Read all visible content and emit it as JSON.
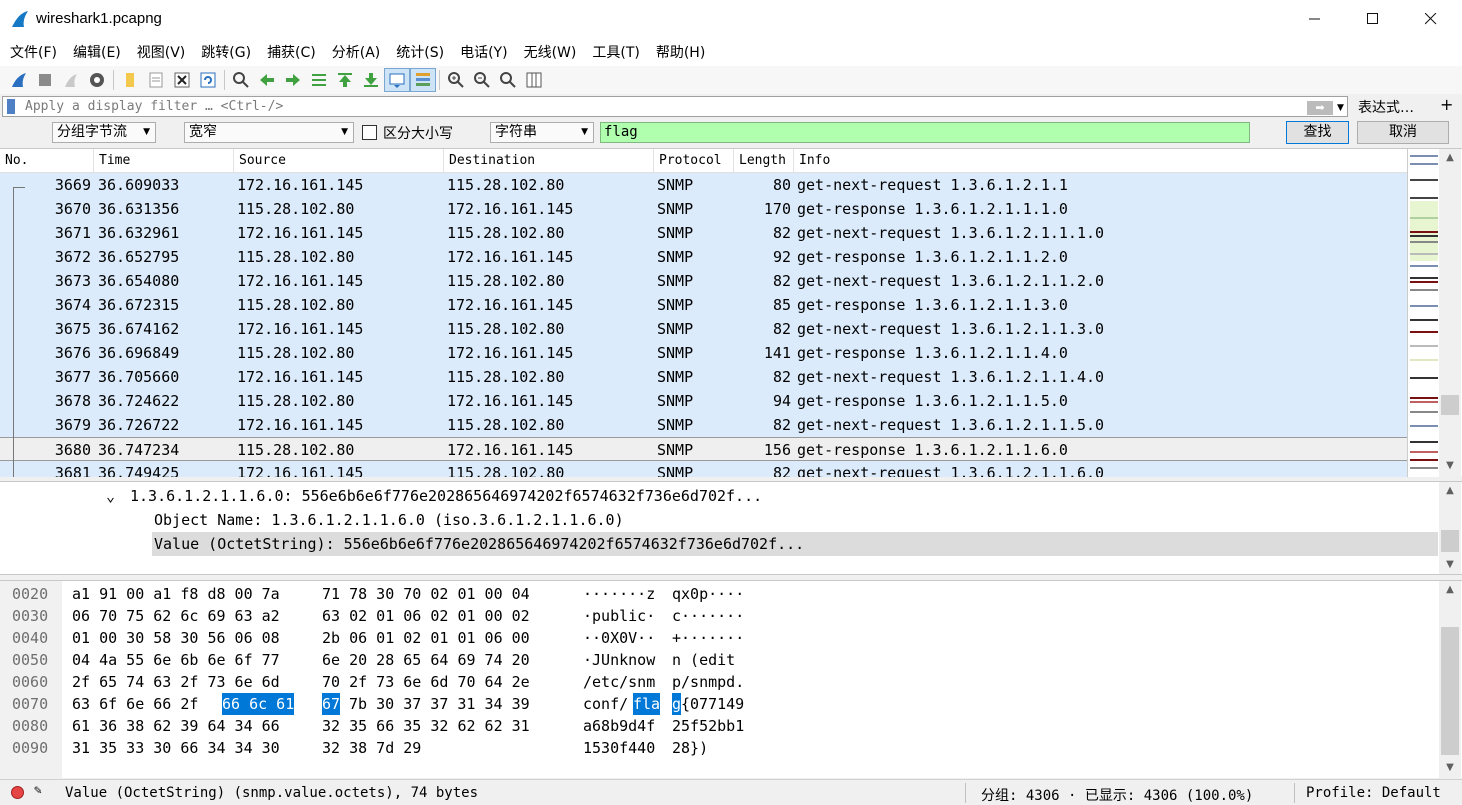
{
  "window": {
    "title": "wireshark1.pcapng"
  },
  "menu": [
    "文件(F)",
    "编辑(E)",
    "视图(V)",
    "跳转(G)",
    "捕获(C)",
    "分析(A)",
    "统计(S)",
    "电话(Y)",
    "无线(W)",
    "工具(T)",
    "帮助(H)"
  ],
  "filter": {
    "placeholder": "Apply a display filter … <Ctrl-/>",
    "expression_label": "表达式…",
    "plus": "+"
  },
  "find": {
    "search_in": "分组字节流",
    "charset": "宽窄",
    "case_label": "区分大小写",
    "type": "字符串",
    "query": "flag",
    "find_label": "查找",
    "cancel_label": "取消"
  },
  "packet_list": {
    "columns": [
      "No.",
      "Time",
      "Source",
      "Destination",
      "Protocol",
      "Length",
      "Info"
    ],
    "rows": [
      {
        "no": "3669",
        "time": "36.609033",
        "src": "172.16.161.145",
        "dst": "115.28.102.80",
        "proto": "SNMP",
        "len": "80",
        "info": "get-next-request 1.3.6.1.2.1.1"
      },
      {
        "no": "3670",
        "time": "36.631356",
        "src": "115.28.102.80",
        "dst": "172.16.161.145",
        "proto": "SNMP",
        "len": "170",
        "info": "get-response 1.3.6.1.2.1.1.1.0"
      },
      {
        "no": "3671",
        "time": "36.632961",
        "src": "172.16.161.145",
        "dst": "115.28.102.80",
        "proto": "SNMP",
        "len": "82",
        "info": "get-next-request 1.3.6.1.2.1.1.1.0"
      },
      {
        "no": "3672",
        "time": "36.652795",
        "src": "115.28.102.80",
        "dst": "172.16.161.145",
        "proto": "SNMP",
        "len": "92",
        "info": "get-response 1.3.6.1.2.1.1.2.0"
      },
      {
        "no": "3673",
        "time": "36.654080",
        "src": "172.16.161.145",
        "dst": "115.28.102.80",
        "proto": "SNMP",
        "len": "82",
        "info": "get-next-request 1.3.6.1.2.1.1.2.0"
      },
      {
        "no": "3674",
        "time": "36.672315",
        "src": "115.28.102.80",
        "dst": "172.16.161.145",
        "proto": "SNMP",
        "len": "85",
        "info": "get-response 1.3.6.1.2.1.1.3.0"
      },
      {
        "no": "3675",
        "time": "36.674162",
        "src": "172.16.161.145",
        "dst": "115.28.102.80",
        "proto": "SNMP",
        "len": "82",
        "info": "get-next-request 1.3.6.1.2.1.1.3.0"
      },
      {
        "no": "3676",
        "time": "36.696849",
        "src": "115.28.102.80",
        "dst": "172.16.161.145",
        "proto": "SNMP",
        "len": "141",
        "info": "get-response 1.3.6.1.2.1.1.4.0"
      },
      {
        "no": "3677",
        "time": "36.705660",
        "src": "172.16.161.145",
        "dst": "115.28.102.80",
        "proto": "SNMP",
        "len": "82",
        "info": "get-next-request 1.3.6.1.2.1.1.4.0"
      },
      {
        "no": "3678",
        "time": "36.724622",
        "src": "115.28.102.80",
        "dst": "172.16.161.145",
        "proto": "SNMP",
        "len": "94",
        "info": "get-response 1.3.6.1.2.1.1.5.0"
      },
      {
        "no": "3679",
        "time": "36.726722",
        "src": "172.16.161.145",
        "dst": "115.28.102.80",
        "proto": "SNMP",
        "len": "82",
        "info": "get-next-request 1.3.6.1.2.1.1.5.0"
      },
      {
        "no": "3680",
        "time": "36.747234",
        "src": "115.28.102.80",
        "dst": "172.16.161.145",
        "proto": "SNMP",
        "len": "156",
        "info": "get-response 1.3.6.1.2.1.1.6.0"
      },
      {
        "no": "3681",
        "time": "36.749425",
        "src": "172.16.161.145",
        "dst": "115.28.102.80",
        "proto": "SNMP",
        "len": "82",
        "info": "get-next-request 1.3.6.1.2.1.1.6.0"
      }
    ],
    "selected_no": "3680"
  },
  "details": {
    "lines": [
      "1.3.6.1.2.1.1.6.0: 556e6b6e6f776e202865646974202f6574632f736e6d702f...",
      "Object Name: 1.3.6.1.2.1.1.6.0 (iso.3.6.1.2.1.1.6.0)",
      "Value (OctetString): 556e6b6e6f776e202865646974202f6574632f736e6d702f..."
    ]
  },
  "bytes": [
    {
      "off": "0020",
      "hex1": "a1 91 00 a1 f8 d8 00 7a",
      "hex2": "71 78 30 70 02 01 00 04",
      "asc1": "·······z",
      "asc2": "qx0p····"
    },
    {
      "off": "0030",
      "hex1": "06 70 75 62 6c 69 63 a2",
      "hex2": "63 02 01 06 02 01 00 02",
      "asc1": "·public·",
      "asc2": "c·······"
    },
    {
      "off": "0040",
      "hex1": "01 00 30 58 30 56 06 08",
      "hex2": "2b 06 01 02 01 01 06 00",
      "asc1": "··0X0V··",
      "asc2": "+·······"
    },
    {
      "off": "0050",
      "hex1": "04 4a 55 6e 6b 6e 6f 77",
      "hex2": "6e 20 28 65 64 69 74 20",
      "asc1": "·JUnknow",
      "asc2": "n (edit "
    },
    {
      "off": "0060",
      "hex1": "2f 65 74 63 2f 73 6e 6d",
      "hex2": "70 2f 73 6e 6d 70 64 2e",
      "asc1": "/etc/snm",
      "asc2": "p/snmpd."
    },
    {
      "off": "0070",
      "hex1a": "63 6f 6e 66 2f ",
      "hex1b": "66 6c 61",
      "hex2a": "67",
      "hex2b": " 7b 30 37 37 31 34 39",
      "asc1a": "conf/",
      "asc1b": "fla",
      "asc2a": "g",
      "asc2b": "{077149"
    },
    {
      "off": "0080",
      "hex1": "61 36 38 62 39 64 34 66",
      "hex2": "32 35 66 35 32 62 62 31",
      "asc1": "a68b9d4f",
      "asc2": "25f52bb1"
    },
    {
      "off": "0090",
      "hex1": "31 35 33 30 66 34 34 30",
      "hex2": "32 38 7d 29",
      "asc1": "1530f440",
      "asc2": "28})"
    }
  ],
  "status": {
    "field": "Value (OctetString) (snmp.value.octets), 74 bytes",
    "packets": "分组: 4306 · 已显示: 4306 (100.0%)",
    "profile": "Profile: Default"
  }
}
